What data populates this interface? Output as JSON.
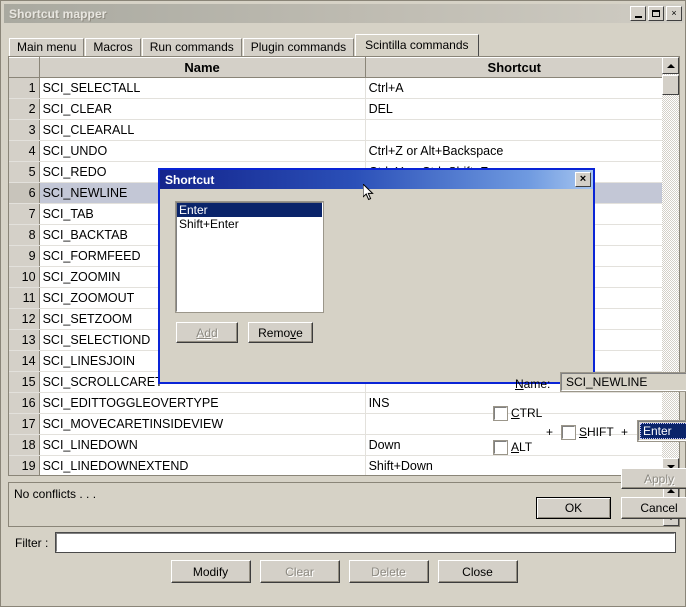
{
  "window": {
    "title": "Shortcut mapper",
    "minimize_label": "minimize",
    "maximize_label": "maximize",
    "close_label": "×"
  },
  "tabs": [
    {
      "label": "Main menu",
      "active": false
    },
    {
      "label": "Macros",
      "active": false
    },
    {
      "label": "Run commands",
      "active": false
    },
    {
      "label": "Plugin commands",
      "active": false
    },
    {
      "label": "Scintilla commands",
      "active": true
    }
  ],
  "table": {
    "headers": {
      "num": "",
      "name": "Name",
      "shortcut": "Shortcut"
    },
    "rows": [
      {
        "num": "1",
        "name": "SCI_SELECTALL",
        "shortcut": "Ctrl+A"
      },
      {
        "num": "2",
        "name": "SCI_CLEAR",
        "shortcut": "DEL"
      },
      {
        "num": "3",
        "name": "SCI_CLEARALL",
        "shortcut": ""
      },
      {
        "num": "4",
        "name": "SCI_UNDO",
        "shortcut": "Ctrl+Z or Alt+Backspace"
      },
      {
        "num": "5",
        "name": "SCI_REDO",
        "shortcut": "Ctrl+Y or Ctrl+Shift+Z"
      },
      {
        "num": "6",
        "name": "SCI_NEWLINE",
        "shortcut": "",
        "selected": true
      },
      {
        "num": "7",
        "name": "SCI_TAB",
        "shortcut": ""
      },
      {
        "num": "8",
        "name": "SCI_BACKTAB",
        "shortcut": ""
      },
      {
        "num": "9",
        "name": "SCI_FORMFEED",
        "shortcut": ""
      },
      {
        "num": "10",
        "name": "SCI_ZOOMIN",
        "shortcut": ""
      },
      {
        "num": "11",
        "name": "SCI_ZOOMOUT",
        "shortcut": ""
      },
      {
        "num": "12",
        "name": "SCI_SETZOOM",
        "shortcut": ""
      },
      {
        "num": "13",
        "name": "SCI_SELECTIOND",
        "shortcut": ""
      },
      {
        "num": "14",
        "name": "SCI_LINESJOIN",
        "shortcut": ""
      },
      {
        "num": "15",
        "name": "SCI_SCROLLCARET",
        "shortcut": ""
      },
      {
        "num": "16",
        "name": "SCI_EDITTOGGLEOVERTYPE",
        "shortcut": "INS"
      },
      {
        "num": "17",
        "name": "SCI_MOVECARETINSIDEVIEW",
        "shortcut": ""
      },
      {
        "num": "18",
        "name": "SCI_LINEDOWN",
        "shortcut": "Down"
      },
      {
        "num": "19",
        "name": "SCI_LINEDOWNEXTEND",
        "shortcut": "Shift+Down"
      }
    ]
  },
  "conflicts": {
    "text": "No conflicts . . ."
  },
  "filter": {
    "label": "Filter :",
    "value": "",
    "placeholder": ""
  },
  "bottom_buttons": [
    {
      "label": "Modify",
      "disabled": false
    },
    {
      "label": "Clear",
      "disabled": true
    },
    {
      "label": "Delete",
      "disabled": true
    },
    {
      "label": "Close",
      "disabled": false
    }
  ],
  "dialog": {
    "title": "Shortcut",
    "close_label": "×",
    "list": [
      {
        "label": "Enter",
        "selected": true
      },
      {
        "label": "Shift+Enter",
        "selected": false
      }
    ],
    "add_label": "Add",
    "remove_label": "Remove",
    "name_label": "Name:",
    "name_value": "SCI_NEWLINE",
    "ctrl_label": "CTRL",
    "shift_label": "SHIFT",
    "alt_label": "ALT",
    "ctrl_checked": false,
    "shift_checked": false,
    "alt_checked": false,
    "plus1": "+",
    "plus2": "+",
    "key_value": "Enter",
    "apply_label": "Apply",
    "ok_label": "OK",
    "cancel_label": "Cancel"
  },
  "colors": {
    "dialog_border": "#0a24d6",
    "selection": "#0a246a",
    "row_selected": "#c3c7d6",
    "face": "#d4d0c8"
  }
}
